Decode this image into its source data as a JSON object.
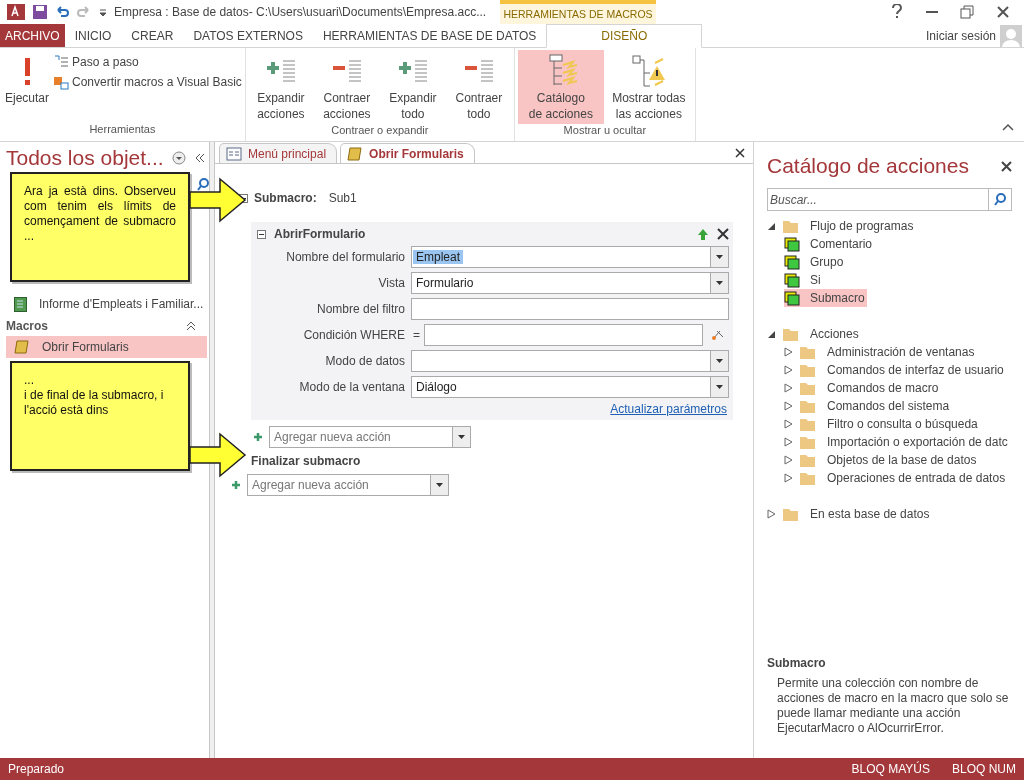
{
  "title_bar": {
    "title": "Empresa : Base de datos- C:\\Users\\usuari\\Documents\\Empresa.acc...",
    "contextual_group": "HERRAMIENTAS DE MACROS"
  },
  "ribbon_tabs": [
    {
      "label": "ARCHIVO",
      "kind": "file",
      "selected": false
    },
    {
      "label": "INICIO",
      "kind": "tab",
      "selected": false
    },
    {
      "label": "CREAR",
      "kind": "tab",
      "selected": false
    },
    {
      "label": "DATOS EXTERNOS",
      "kind": "tab",
      "selected": false
    },
    {
      "label": "HERRAMIENTAS DE BASE DE DATOS",
      "kind": "tab",
      "selected": false
    },
    {
      "label": "DISEÑO",
      "kind": "contextual",
      "selected": true
    }
  ],
  "account": "Iniciar sesión",
  "ribbon_groups": [
    {
      "label": "Herramientas",
      "buttons": [
        {
          "label": "Ejecutar",
          "kind": "run",
          "selected": false
        },
        {
          "label": "Paso a paso",
          "kind": "step",
          "selected": false
        },
        {
          "label": "Convertir macros a Visual Basic",
          "kind": "convert",
          "selected": false
        }
      ]
    },
    {
      "label": "Contraer o expandir",
      "buttons": [
        {
          "label": "Expandir acciones",
          "kind": "expand",
          "selected": false
        },
        {
          "label": "Contraer acciones",
          "kind": "collapse",
          "selected": false
        },
        {
          "label": "Expandir todo",
          "kind": "expand",
          "selected": false
        },
        {
          "label": "Contraer todo",
          "kind": "collapse",
          "selected": false
        }
      ]
    },
    {
      "label": "Mostrar u ocultar",
      "buttons": [
        {
          "label": "Catálogo de acciones",
          "kind": "catalog",
          "selected": true
        },
        {
          "label": "Mostrar todas las acciones",
          "kind": "showall",
          "selected": false
        }
      ]
    }
  ],
  "nav": {
    "title": "Todos los objet...",
    "items": [
      {
        "label": "Informe d'Empleats i Familiar...",
        "kind": "report",
        "selected": false
      },
      {
        "label": "Macros",
        "kind": "section"
      },
      {
        "label": "Obrir Formularis",
        "kind": "macro",
        "selected": true
      }
    ]
  },
  "doc_tabs": [
    {
      "label": "Menú principal",
      "kind": "form",
      "selected": false
    },
    {
      "label": "Obrir Formularis",
      "kind": "macro",
      "selected": true
    }
  ],
  "macro": {
    "submacro_label": "Submacro:",
    "submacro_name": "Sub1",
    "action": {
      "name": "AbrirFormulario",
      "fields": [
        {
          "label": "Nombre del formulario",
          "kind": "combo",
          "value": "Empleat",
          "highlighted": true
        },
        {
          "label": "Vista",
          "kind": "combo",
          "value": "Formulario",
          "highlighted": false
        },
        {
          "label": "Nombre del filtro",
          "kind": "text"
        },
        {
          "label": "Condición WHERE",
          "kind": "expression",
          "prefix": "="
        },
        {
          "label": "Modo de datos",
          "kind": "combo"
        },
        {
          "label": "Modo de la ventana",
          "kind": "combo",
          "value": "Diálogo",
          "highlighted": false
        }
      ],
      "link": "Actualizar parámetros"
    },
    "inner_add_placeholder": "Agregar nueva acción",
    "end_label": "Finalizar submacro",
    "outer_add_placeholder": "Agregar nueva acción"
  },
  "catalog": {
    "title": "Catálogo de acciones",
    "search_placeholder": "Buscar...",
    "tree": [
      {
        "label": "Flujo de programas",
        "kind": "folder",
        "expanded": true,
        "selected": false,
        "children": [
          {
            "label": "Comentario",
            "kind": "action",
            "selected": false
          },
          {
            "label": "Grupo",
            "kind": "action",
            "selected": false
          },
          {
            "label": "Si",
            "kind": "action",
            "selected": false
          },
          {
            "label": "Submacro",
            "kind": "action",
            "selected": true
          }
        ]
      },
      {
        "label": "Acciones",
        "kind": "folder",
        "expanded": true,
        "selected": false,
        "children": [
          {
            "label": "Administración de ventanas",
            "kind": "folder",
            "expanded": false,
            "selected": false
          },
          {
            "label": "Comandos de interfaz de usuario",
            "kind": "folder",
            "expanded": false,
            "selected": false
          },
          {
            "label": "Comandos de macro",
            "kind": "folder",
            "expanded": false,
            "selected": false
          },
          {
            "label": "Comandos del sistema",
            "kind": "folder",
            "expanded": false,
            "selected": false
          },
          {
            "label": "Filtro o consulta o búsqueda",
            "kind": "folder",
            "expanded": false,
            "selected": false
          },
          {
            "label": "Importación o exportación de datc",
            "kind": "folder",
            "expanded": false,
            "selected": false
          },
          {
            "label": "Objetos de la base de datos",
            "kind": "folder",
            "expanded": false,
            "selected": false
          },
          {
            "label": "Operaciones de entrada de datos",
            "kind": "folder",
            "expanded": false,
            "selected": false
          }
        ]
      },
      {
        "label": "En esta base de datos",
        "kind": "folder",
        "expanded": false,
        "selected": false
      }
    ],
    "help_title": "Submacro",
    "help_text": "Permite una colección con nombre de acciones de macro en la macro que solo se puede llamar mediante una acción EjecutarMacro o AlOcurrirError."
  },
  "callouts": [
    {
      "lines": [
        "Ara ja està dins. Observeu com tenim els límits de començament de submacro ..."
      ],
      "justify": true
    },
    {
      "lines": [
        "...",
        "i de final de la submacro, i l'acció està dins"
      ],
      "justify": false
    }
  ],
  "status_bar": {
    "left": "Preparado",
    "right": [
      "BLOQ MAYÚS",
      "BLOQ NUM"
    ]
  }
}
